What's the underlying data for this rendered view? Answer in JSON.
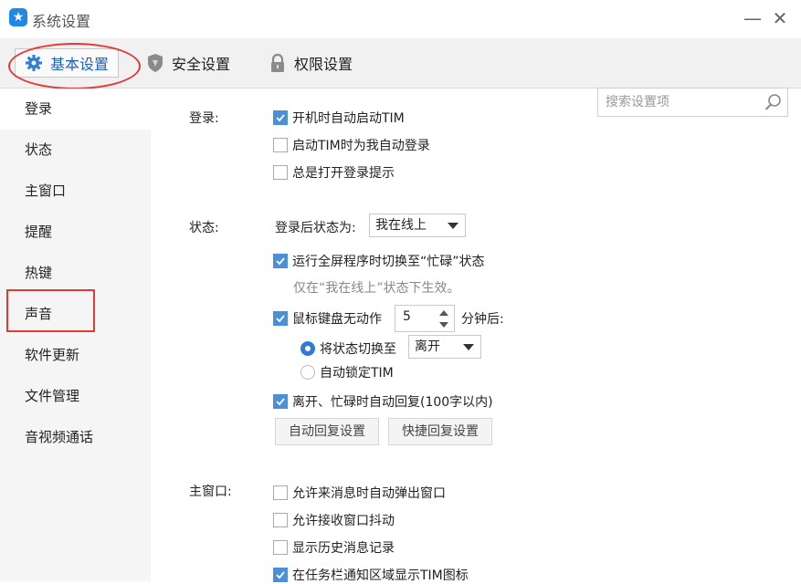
{
  "window": {
    "title": "系统设置",
    "minimize": "—",
    "close": "✕"
  },
  "tabs": [
    {
      "label": "基本设置"
    },
    {
      "label": "安全设置"
    },
    {
      "label": "权限设置"
    }
  ],
  "search": {
    "placeholder": "搜索设置项"
  },
  "sidebar": {
    "items": [
      {
        "label": "登录"
      },
      {
        "label": "状态"
      },
      {
        "label": "主窗口"
      },
      {
        "label": "提醒"
      },
      {
        "label": "热键"
      },
      {
        "label": "声音"
      },
      {
        "label": "软件更新"
      },
      {
        "label": "文件管理"
      },
      {
        "label": "音视频通话"
      }
    ]
  },
  "login": {
    "label": "登录:",
    "options": [
      {
        "label": "开机时自动启动TIM",
        "checked": true
      },
      {
        "label": "启动TIM时为我自动登录",
        "checked": false
      },
      {
        "label": "总是打开登录提示",
        "checked": false
      }
    ]
  },
  "status": {
    "label": "状态:",
    "after_login_label": "登录后状态为:",
    "after_login_value": "我在线上",
    "fullscreen": {
      "label": "运行全屏程序时切换至“忙碌”状态",
      "checked": true
    },
    "fullscreen_hint": "仅在“我在线上”状态下生效。",
    "idle": {
      "label": "鼠标键盘无动作",
      "checked": true
    },
    "idle_minutes": "5",
    "idle_suffix": "分钟后:",
    "switch_radio": {
      "label": "将状态切换至",
      "checked": true
    },
    "switch_value": "离开",
    "lock_radio": {
      "label": "自动锁定TIM",
      "checked": false
    },
    "auto_reply": {
      "label": "离开、忙碌时自动回复(100字以内)",
      "checked": true
    },
    "auto_reply_button": "自动回复设置",
    "quick_reply_button": "快捷回复设置"
  },
  "main_window": {
    "label": "主窗口:",
    "options": [
      {
        "label": "允许来消息时自动弹出窗口",
        "checked": false
      },
      {
        "label": "允许接收窗口抖动",
        "checked": false
      },
      {
        "label": "显示历史消息记录",
        "checked": false
      },
      {
        "label": "在任务栏通知区域显示TIM图标",
        "checked": true
      }
    ]
  },
  "colors": {
    "accent": "#2f7bd6",
    "check": "#4a90d9",
    "highlight": "#e53935"
  }
}
